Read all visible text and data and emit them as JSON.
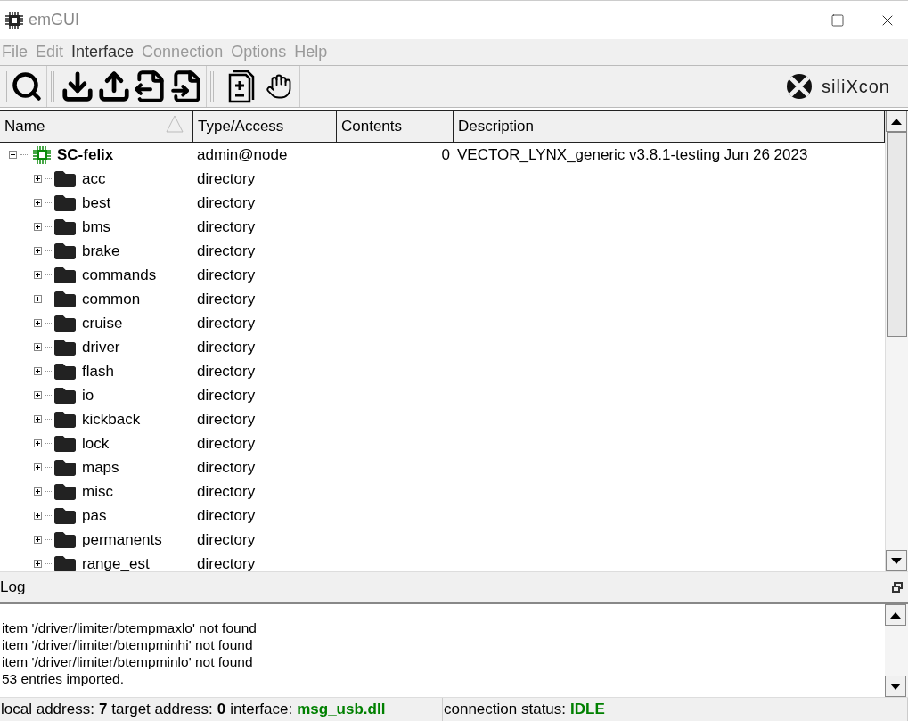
{
  "window": {
    "title": "emGUI"
  },
  "menu": [
    {
      "label": "File",
      "disabled": true
    },
    {
      "label": "Edit",
      "disabled": true
    },
    {
      "label": "Interface",
      "disabled": false
    },
    {
      "label": "Connection",
      "disabled": true
    },
    {
      "label": "Options",
      "disabled": true
    },
    {
      "label": "Help",
      "disabled": true
    }
  ],
  "logo": {
    "text": "siliXcon"
  },
  "table": {
    "columns": [
      "Name",
      "Type/Access",
      "Contents",
      "Description"
    ],
    "rows": [
      {
        "name": "SC-felix",
        "type": "admin@node",
        "contents": "0",
        "description": "VECTOR_LYNX_generic v3.8.1-testing Jun 26 2023",
        "expanded": true,
        "children": [
          {
            "name": "acc",
            "type": "directory",
            "expanded": false
          },
          {
            "name": "best",
            "type": "directory",
            "expanded": false
          },
          {
            "name": "bms",
            "type": "directory",
            "expanded": false
          },
          {
            "name": "brake",
            "type": "directory",
            "expanded": false
          },
          {
            "name": "commands",
            "type": "directory",
            "expanded": false
          },
          {
            "name": "common",
            "type": "directory",
            "expanded": false
          },
          {
            "name": "cruise",
            "type": "directory",
            "expanded": false
          },
          {
            "name": "driver",
            "type": "directory",
            "expanded": false
          },
          {
            "name": "flash",
            "type": "directory",
            "expanded": false
          },
          {
            "name": "io",
            "type": "directory",
            "expanded": false
          },
          {
            "name": "kickback",
            "type": "directory",
            "expanded": false
          },
          {
            "name": "lock",
            "type": "directory",
            "expanded": false
          },
          {
            "name": "maps",
            "type": "directory",
            "expanded": false
          },
          {
            "name": "misc",
            "type": "directory",
            "expanded": false
          },
          {
            "name": "pas",
            "type": "directory",
            "expanded": false
          },
          {
            "name": "permanents",
            "type": "directory",
            "expanded": false
          },
          {
            "name": "range_est",
            "type": "directory",
            "expanded": false
          }
        ]
      }
    ]
  },
  "log": {
    "title": "Log",
    "lines": [
      "item '/driver/limiter/btempmaxlo' not found",
      "item '/driver/limiter/btempminhi' not found",
      "item '/driver/limiter/btempminlo' not found",
      "53 entries imported."
    ]
  },
  "status_bar": [
    {
      "fields": [
        {
          "label": "local address:",
          "value": "7",
          "color": "#000000"
        },
        {
          "label": "target address:",
          "value": "0",
          "color": "#000000"
        },
        {
          "label": "interface:",
          "value": "msg_usb.dll",
          "color": "#008000"
        }
      ]
    },
    {
      "fields": [
        {
          "label": "connection status:",
          "value": "IDLE",
          "color": "#008000"
        }
      ]
    }
  ]
}
